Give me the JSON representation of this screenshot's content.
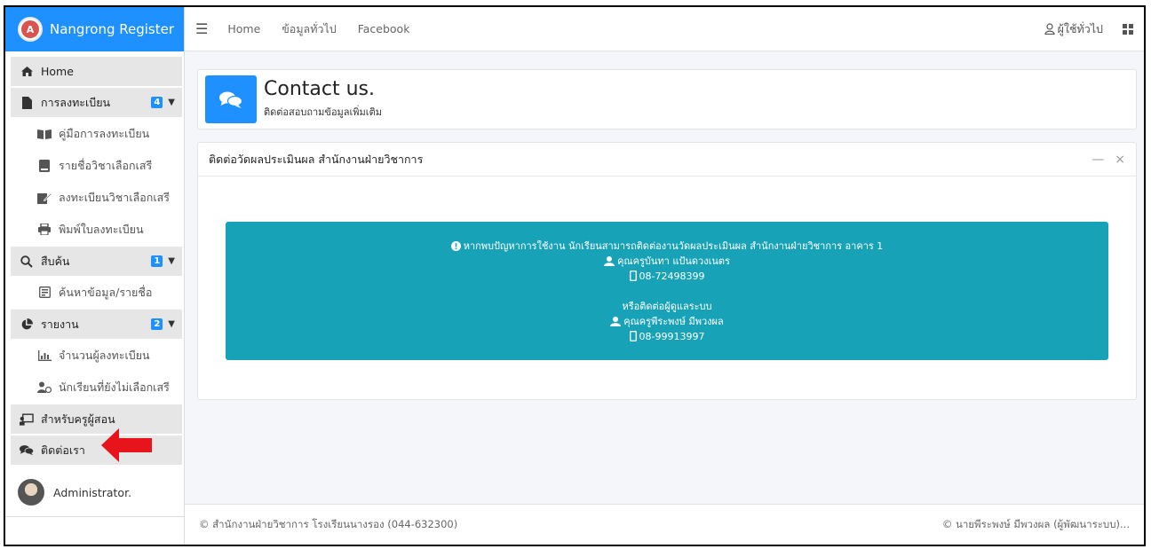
{
  "brand": {
    "title": "Nangrong Register",
    "logo_letter": "A"
  },
  "sidebar": {
    "items": [
      {
        "label": "Home",
        "icon": "home-icon"
      },
      {
        "label": "การลงทะเบียน",
        "icon": "file-icon",
        "badge": "4"
      },
      {
        "label": "คู่มือการลงทะเบียน",
        "icon": "book-open-icon"
      },
      {
        "label": "รายชื่อวิชาเลือกเสรี",
        "icon": "book-icon"
      },
      {
        "label": "ลงทะเบียนวิชาเลือกเสรี",
        "icon": "edit-icon"
      },
      {
        "label": "พิมพ์ใบลงทะเบียน",
        "icon": "print-icon"
      },
      {
        "label": "สืบค้น",
        "icon": "search-icon",
        "badge": "1"
      },
      {
        "label": "ค้นหาข้อมูล/รายชื่อ",
        "icon": "id-card-icon"
      },
      {
        "label": "รายงาน",
        "icon": "pie-chart-icon",
        "badge": "2"
      },
      {
        "label": "จำนวนผู้ลงทะเบียน",
        "icon": "bar-chart-icon"
      },
      {
        "label": "นักเรียนที่ยังไม่เลือกเสรี",
        "icon": "user-clock-icon"
      },
      {
        "label": "สำหรับครูผู้สอน",
        "icon": "chalkboard-teacher-icon"
      },
      {
        "label": "ติดต่อเรา",
        "icon": "comments-icon"
      }
    ],
    "user": {
      "name": "Administrator."
    }
  },
  "topbar": {
    "links": [
      "Home",
      "ข้อมูลทั่วไป",
      "Facebook"
    ],
    "user_menu": "ผู้ใช้ทั่วไป"
  },
  "header": {
    "title": "Contact us.",
    "subtitle": "ติดต่อสอบถามข้อมูลเพิ่มเติม"
  },
  "card": {
    "title": "ติดต่อวัดผลประเมินผล สำนักงานฝ่ายวิชาการ",
    "info": {
      "line1": "หากพบปัญหาการใช้งาน นักเรียนสามารถติดต่องานวัดผลประเมินผล สำนักงานฝ่ายวิชาการ อาคาร 1",
      "contact1_name": "คุณครูบันทา แป้นดวงเนตร",
      "contact1_phone": "08-72498399",
      "line2": "หรือติดต่อผู้ดูแลระบบ",
      "contact2_name": "คุณครูพีระพงษ์ มีพวงผล",
      "contact2_phone": "08-99913997"
    }
  },
  "footer": {
    "left": "© สำนักงานฝ่ายวิชาการ โรงเรียนนางรอง (044-632300)",
    "right": "© นายพีระพงษ์ มีพวงผล (ผู้พัฒนาระบบ)..."
  },
  "colors": {
    "primary": "#1e90ff",
    "info": "#17a2b8",
    "annotation_arrow": "#e8141b"
  }
}
